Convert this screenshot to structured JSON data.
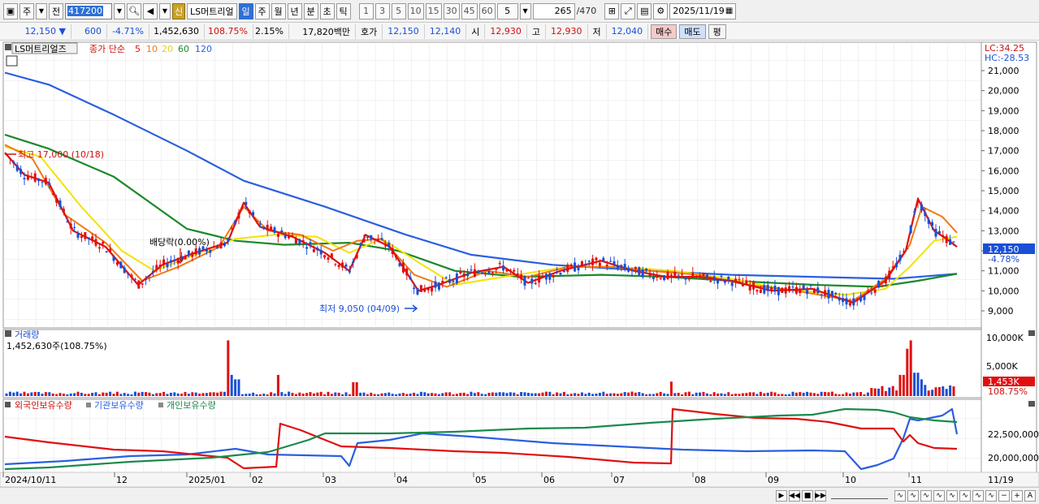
{
  "toolbar": {
    "market_label": "주",
    "prev_label": "전",
    "stock_code": "417200",
    "new_badge": "신",
    "stock_name": "LS머트리얼",
    "periods": [
      "일",
      "주",
      "월",
      "년",
      "분",
      "초",
      "틱"
    ],
    "active_period": "일",
    "intervals": [
      "1",
      "3",
      "5",
      "10",
      "15",
      "30",
      "45",
      "60"
    ],
    "interval_value": "5",
    "count_value": "265",
    "count_total": "/470",
    "date_value": "2025/11/19"
  },
  "quote": {
    "price": "12,150",
    "direction": "▼",
    "change": "600",
    "change_pct": "-4.71%",
    "volume": "1,452,630",
    "volume_ratio": "108.75%",
    "turnover_pct": "2.15%",
    "amount": "17,820백만",
    "hoga_label": "호가",
    "ask": "12,150",
    "bid": "12,140",
    "open_label": "시",
    "open": "12,930",
    "high_label": "고",
    "high": "12,930",
    "low_label": "저",
    "low": "12,040",
    "buy_label": "매수",
    "sell_label": "매도",
    "pyeong_label": "평"
  },
  "price_panel": {
    "name_tag": "LS머트리얼즈",
    "indicator_label": "종가 단순",
    "ma_periods": [
      "5",
      "10",
      "20",
      "60",
      "120"
    ],
    "lc_label": "LC:34.25",
    "hc_label": "HC:-28.53",
    "high_marker": "최고 17,000 (10/18)",
    "low_marker": "최저 9,050 (04/09)",
    "dividend_marker": "배당락(0.00%)",
    "current_price_tag": "12,150",
    "current_pct_tag": "-4.78%",
    "y_ticks": [
      "21,000",
      "20,000",
      "19,000",
      "18,000",
      "17,000",
      "16,000",
      "15,000",
      "14,000",
      "13,000",
      "12,000",
      "11,000",
      "10,000",
      "9,000"
    ]
  },
  "volume_panel": {
    "title": "거래량",
    "value_text": "1,452,630주(108.75%)",
    "y_ticks": [
      "10,000K",
      "5,000K"
    ],
    "current_tag": "1,453K",
    "current_pct": "108.75%"
  },
  "holdings_panel": {
    "legend": [
      "외국인보유수량",
      "기관보유수량",
      "개인보유수량"
    ],
    "y_ticks": [
      "22,500,000",
      "20,000,000"
    ]
  },
  "x_axis": {
    "labels": [
      "2024/10/11",
      "12",
      "2025/01",
      "02",
      "03",
      "04",
      "05",
      "06",
      "07",
      "08",
      "09",
      "10",
      "11"
    ],
    "end_label": "11/19"
  },
  "colors": {
    "ma5": "#e01010",
    "ma10": "#f07a10",
    "ma20": "#f2e200",
    "ma60": "#1a8a2a",
    "ma120": "#2a5fe0",
    "up": "#e01010",
    "down": "#1a4fd6",
    "foreign": "#e01010",
    "institution": "#2a5fe0",
    "individual": "#1a8a4a"
  }
}
